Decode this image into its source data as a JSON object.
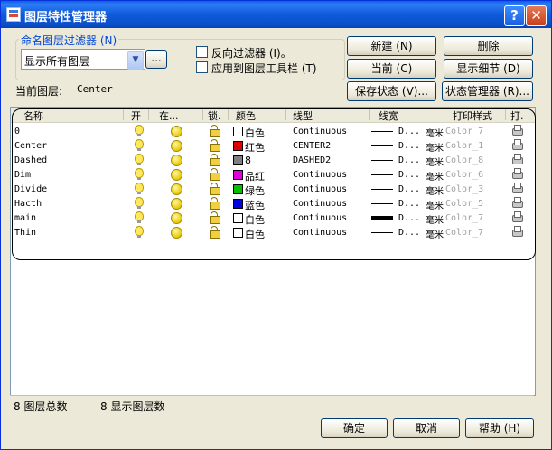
{
  "window": {
    "title": "图层特性管理器",
    "help_button": "?",
    "close_button": "✕"
  },
  "filter_group": {
    "legend": "命名图层过滤器 (N)",
    "combo_value": "显示所有图层",
    "browse_button": "...",
    "invert_filter": "反向过滤器 (I)。",
    "apply_to_toolbar": "应用到图层工具栏 (T)"
  },
  "current_layer": {
    "label": "当前图层:",
    "value": "Center"
  },
  "buttons": {
    "new": "新建 (N)",
    "delete": "删除",
    "current": "当前 (C)",
    "show_details": "显示细节 (D)",
    "save_state": "保存状态 (V)...",
    "state_manager": "状态管理器 (R)..."
  },
  "table": {
    "headers": [
      "名称",
      "开",
      "在...",
      "锁.",
      "颜色",
      "线型",
      "线宽",
      "打印样式",
      "打."
    ],
    "rows": [
      {
        "name": "0",
        "color_name": "白色",
        "color_hex": "#ffffff",
        "linetype": "Continuous",
        "lw": "D...",
        "unit": "毫米",
        "plot_style": "Color_7",
        "thick": false
      },
      {
        "name": "Center",
        "color_name": "红色",
        "color_hex": "#e00000",
        "linetype": "CENTER2",
        "lw": "D...",
        "unit": "毫米",
        "plot_style": "Color_1",
        "thick": false
      },
      {
        "name": "Dashed",
        "color_name": "8",
        "color_hex": "#808080",
        "linetype": "DASHED2",
        "lw": "D...",
        "unit": "毫米",
        "plot_style": "Color_8",
        "thick": false
      },
      {
        "name": "Dim",
        "color_name": "品红",
        "color_hex": "#e000e0",
        "linetype": "Continuous",
        "lw": "D...",
        "unit": "毫米",
        "plot_style": "Color_6",
        "thick": false
      },
      {
        "name": "Divide",
        "color_name": "绿色",
        "color_hex": "#00c000",
        "linetype": "Continuous",
        "lw": "D...",
        "unit": "毫米",
        "plot_style": "Color_3",
        "thick": false
      },
      {
        "name": "Hacth",
        "color_name": "蓝色",
        "color_hex": "#0000e0",
        "linetype": "Continuous",
        "lw": "D...",
        "unit": "毫米",
        "plot_style": "Color_5",
        "thick": false
      },
      {
        "name": "main",
        "color_name": "白色",
        "color_hex": "#ffffff",
        "linetype": "Continuous",
        "lw": "D...",
        "unit": "毫米",
        "plot_style": "Color_7",
        "thick": true
      },
      {
        "name": "Thin",
        "color_name": "白色",
        "color_hex": "#ffffff",
        "linetype": "Continuous",
        "lw": "D...",
        "unit": "毫米",
        "plot_style": "Color_7",
        "thick": false
      }
    ]
  },
  "status": {
    "total": "8 图层总数",
    "shown": "8 显示图层数"
  },
  "footer": {
    "ok": "确定",
    "cancel": "取消",
    "help": "帮助 (H)"
  }
}
